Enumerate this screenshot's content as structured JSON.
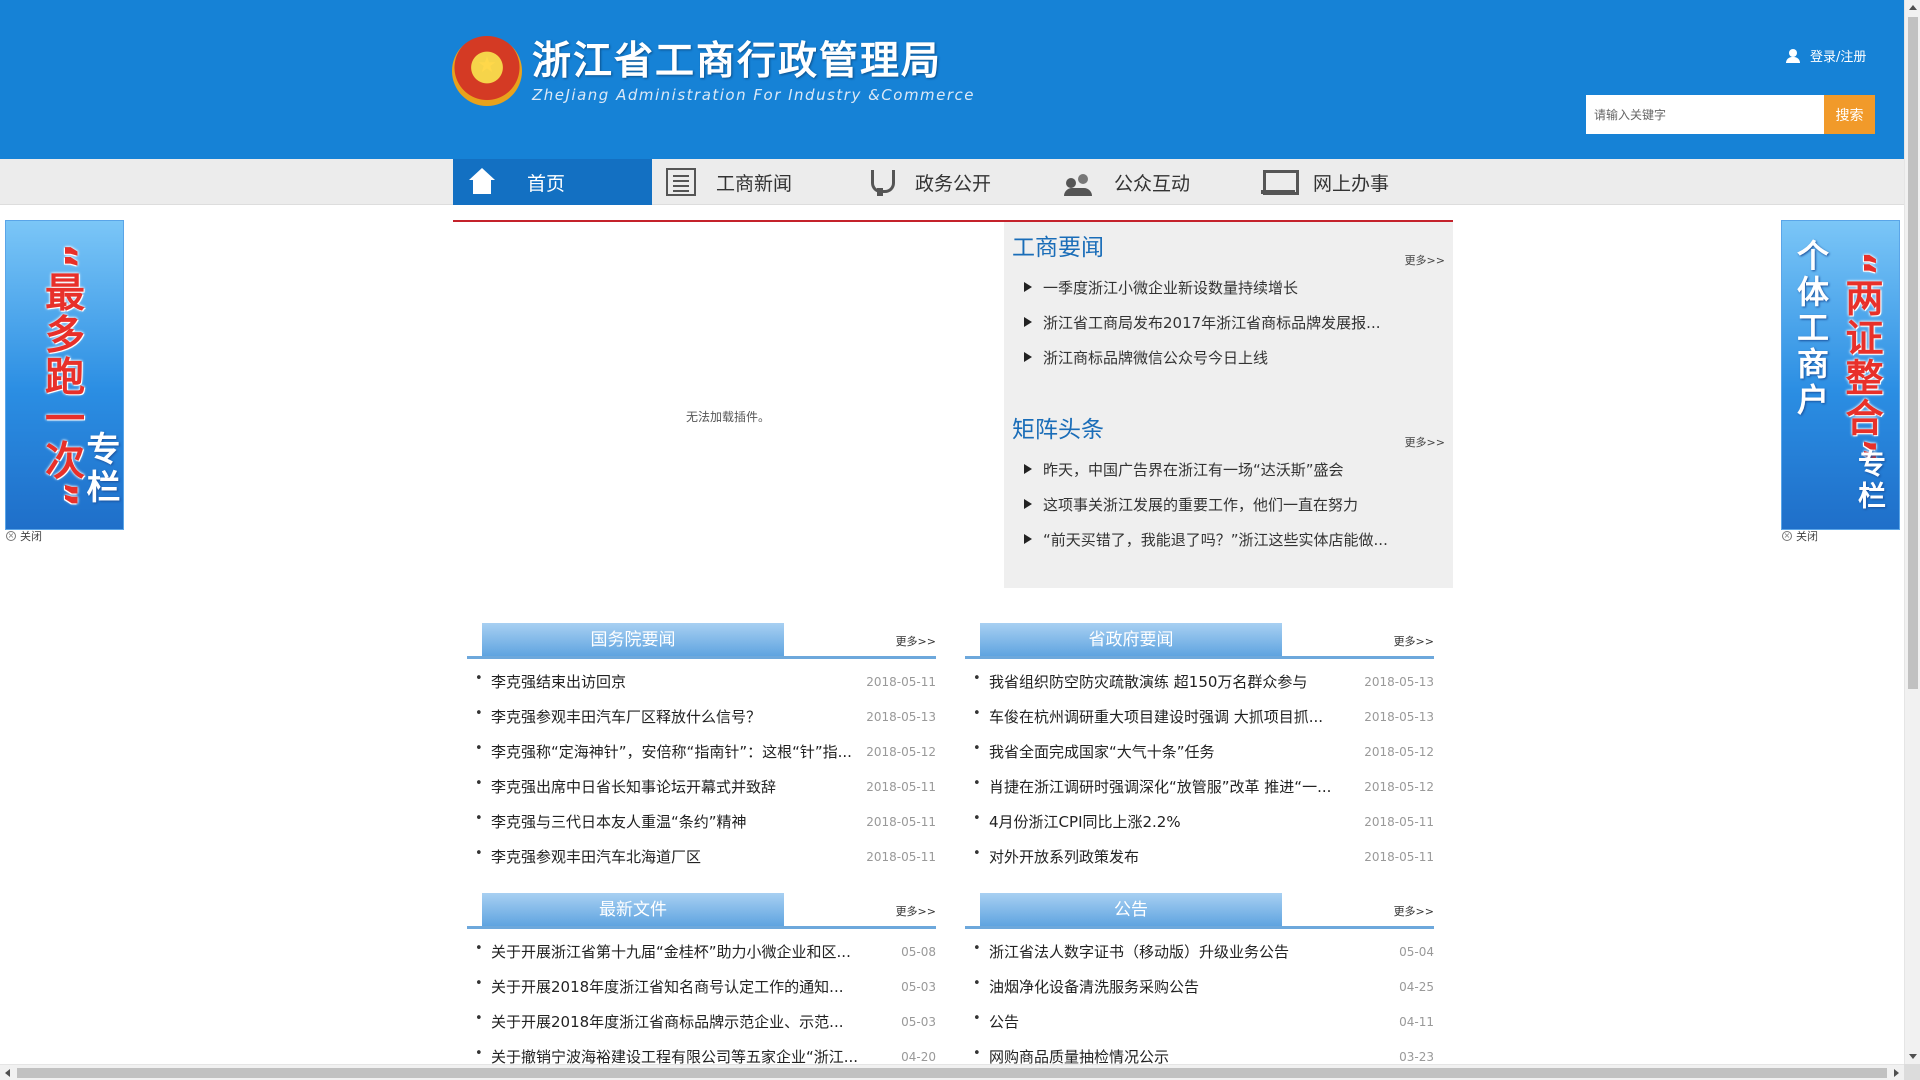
{
  "header": {
    "logo_cn": "浙江省工商行政管理局",
    "logo_en": "ZheJiang Administration For Industry &Commerce",
    "login_label": "登录/注册",
    "search_placeholder": "请输入关键字",
    "search_button": "搜索"
  },
  "nav": {
    "items": [
      {
        "label": "首页",
        "icon": "home-icon"
      },
      {
        "label": "工商新闻",
        "icon": "newspaper-icon"
      },
      {
        "label": "政务公开",
        "icon": "government-icon"
      },
      {
        "label": "公众互动",
        "icon": "people-icon"
      },
      {
        "label": "网上办事",
        "icon": "computer-icon"
      }
    ]
  },
  "main": {
    "plugin_message": "无法加载插件。",
    "gongshang_news": {
      "title": "工商要闻",
      "more": "更多>>",
      "items": [
        "一季度浙江小微企业新设数量持续增长",
        "浙江省工商局发布2017年浙江省商标品牌发展报...",
        "浙江商标品牌微信公众号今日上线"
      ]
    },
    "matrix_headlines": {
      "title": "矩阵头条",
      "more": "更多>>",
      "items": [
        "昨天，中国广告界在浙江有一场“达沃斯”盛会",
        "这项事关浙江发展的重要工作，他们一直在努力",
        "“前天买错了，我能退了吗？”浙江这些实体店能做..."
      ]
    }
  },
  "side_banners": {
    "left": {
      "big_text": "“最多跑一次”",
      "small_text": "专栏",
      "close": "关闭"
    },
    "right": {
      "big_text": "“两证整合”",
      "small_text": "个体工商户",
      "tail_text": "专栏",
      "close": "关闭"
    }
  },
  "blocks": {
    "state_council": {
      "title": "国务院要闻",
      "more": "更多>>",
      "items": [
        {
          "title": "李克强结束出访回京",
          "date": "2018-05-11"
        },
        {
          "title": "李克强参观丰田汽车厂区释放什么信号？",
          "date": "2018-05-13"
        },
        {
          "title": "李克强称“定海神针”，安倍称“指南针”：这根“针”指...",
          "date": "2018-05-12"
        },
        {
          "title": "李克强出席中日省长知事论坛开幕式并致辞",
          "date": "2018-05-11"
        },
        {
          "title": "李克强与三代日本友人重温“条约”精神",
          "date": "2018-05-11"
        },
        {
          "title": "李克强参观丰田汽车北海道厂区",
          "date": "2018-05-11"
        }
      ]
    },
    "provincial_gov": {
      "title": "省政府要闻",
      "more": "更多>>",
      "items": [
        {
          "title": "我省组织防空防灾疏散演练 超150万名群众参与",
          "date": "2018-05-13"
        },
        {
          "title": "车俊在杭州调研重大项目建设时强调 大抓项目抓...",
          "date": "2018-05-13"
        },
        {
          "title": "我省全面完成国家“大气十条”任务",
          "date": "2018-05-12"
        },
        {
          "title": "肖捷在浙江调研时强调深化“放管服”改革 推进“一...",
          "date": "2018-05-12"
        },
        {
          "title": "4月份浙江CPI同比上涨2.2%",
          "date": "2018-05-11"
        },
        {
          "title": "对外开放系列政策发布",
          "date": "2018-05-11"
        }
      ]
    },
    "latest_files": {
      "title": "最新文件",
      "more": "更多>>",
      "items": [
        {
          "title": "关于开展浙江省第十九届“金桂杯”助力小微企业和区...",
          "date": "05-08"
        },
        {
          "title": "关于开展2018年度浙江省知名商号认定工作的通知...",
          "date": "05-03"
        },
        {
          "title": "关于开展2018年度浙江省商标品牌示范企业、示范...",
          "date": "05-03"
        },
        {
          "title": "关于撤销宁波海裕建设工程有限公司等五家企业“浙江...",
          "date": "04-20"
        }
      ]
    },
    "announcements": {
      "title": "公告",
      "more": "更多>>",
      "items": [
        {
          "title": "浙江省法人数字证书（移动版）升级业务公告",
          "date": "05-04"
        },
        {
          "title": "油烟净化设备清洗服务采购公告",
          "date": "04-25"
        },
        {
          "title": "公告",
          "date": "04-11"
        },
        {
          "title": "网购商品质量抽检情况公示",
          "date": "03-23"
        }
      ]
    }
  },
  "colors": {
    "header_blue": "#1682d6",
    "nav_active": "#1370c2",
    "search_orange": "#f19a2a",
    "accent_red": "#c4222b",
    "title_blue": "#1a6db8"
  }
}
